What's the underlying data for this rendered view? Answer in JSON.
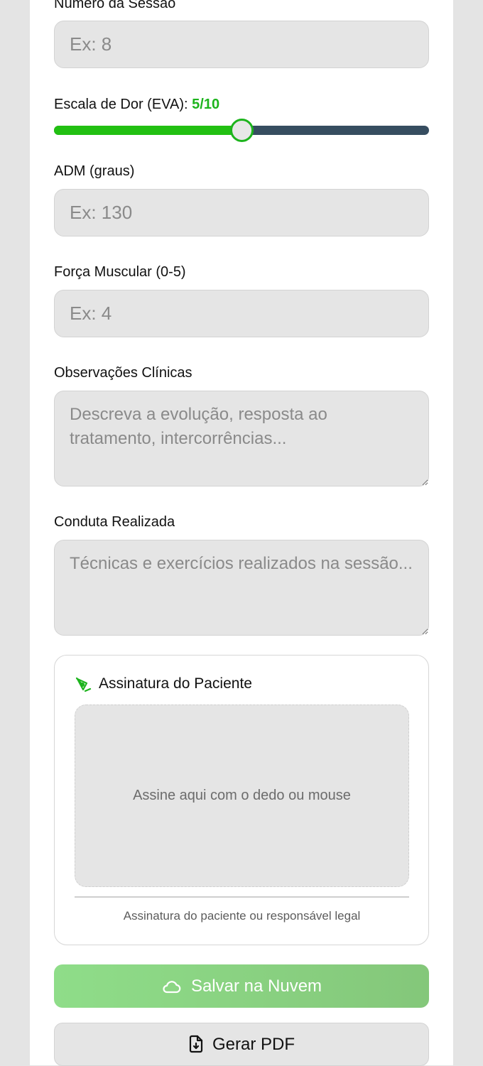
{
  "form": {
    "session_number": {
      "label": "Número da Sessão",
      "placeholder": "Ex: 8",
      "value": ""
    },
    "pain_scale": {
      "label": "Escala de Dor (EVA):",
      "value_text": "5/10",
      "value": 5,
      "max": 10
    },
    "rom": {
      "label": "ADM (graus)",
      "placeholder": "Ex: 130",
      "value": ""
    },
    "strength": {
      "label": "Força Muscular (0-5)",
      "placeholder": "Ex: 4",
      "value": ""
    },
    "clinical_notes": {
      "label": "Observações Clínicas",
      "placeholder": "Descreva a evolução, resposta ao tratamento, intercorrências..."
    },
    "procedure": {
      "label": "Conduta Realizada",
      "placeholder": "Técnicas e exercícios realizados na sessão..."
    }
  },
  "signature": {
    "title": "Assinatura do Paciente",
    "icon": "signature-pen-icon",
    "pad_placeholder": "Assine aqui com o dedo ou mouse",
    "caption": "Assinatura do paciente ou responsável legal"
  },
  "actions": {
    "save_label": "Salvar na Nuvem",
    "save_icon": "cloud-icon",
    "pdf_label": "Gerar PDF",
    "pdf_icon": "file-download-icon"
  },
  "colors": {
    "accent": "#1db41d",
    "slider_track": "#364d60",
    "save_button": "#8fdd89"
  }
}
